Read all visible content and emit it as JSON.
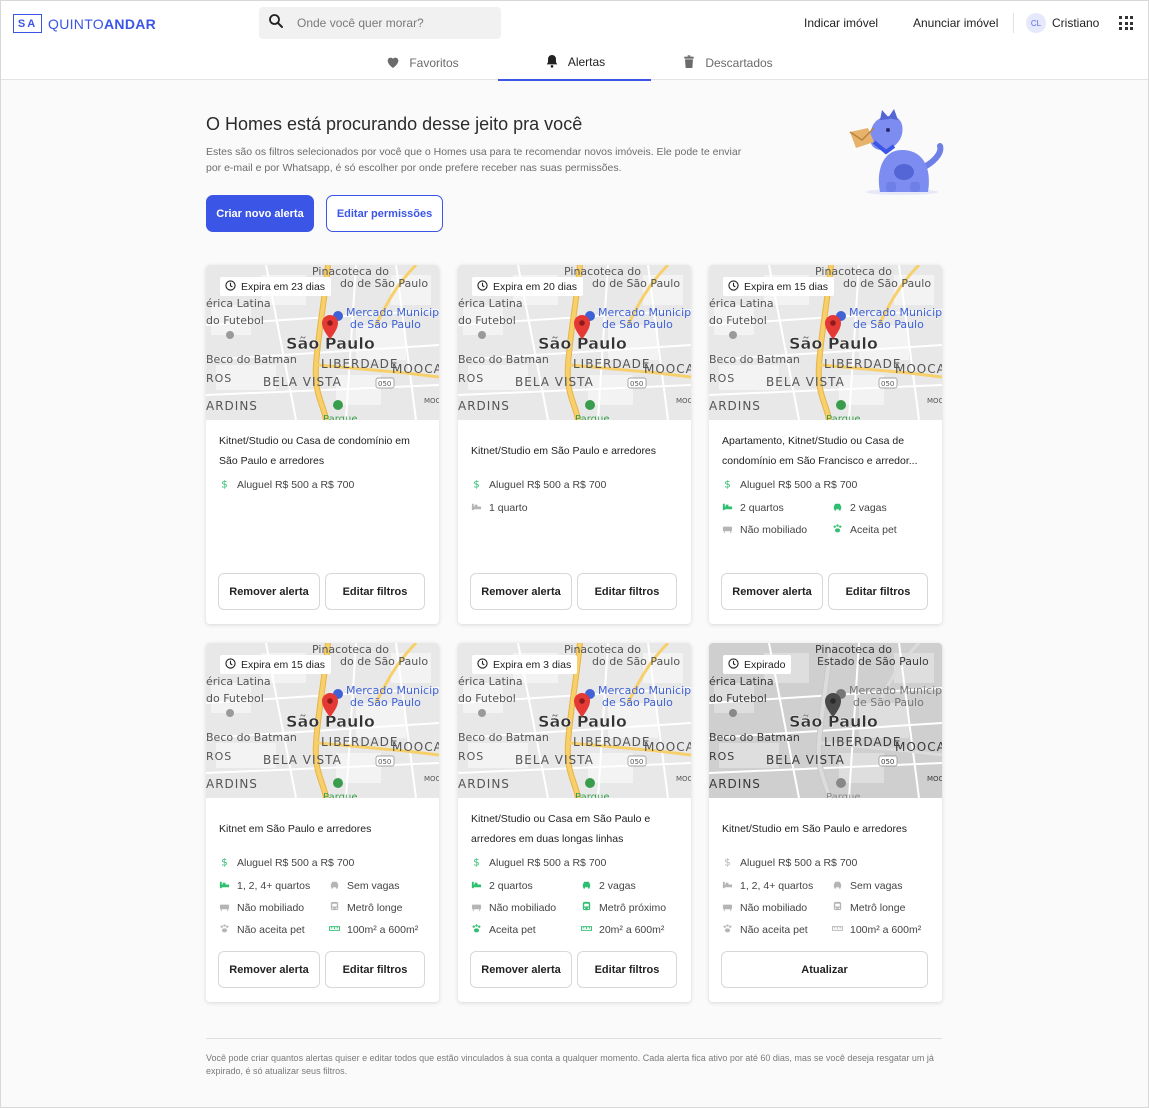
{
  "brand": {
    "mark": "SA",
    "name_light": "QUINTO",
    "name_bold": "ANDAR",
    "accent": "#3b55e6"
  },
  "search": {
    "placeholder": "Onde você quer morar?"
  },
  "header_links": {
    "indicar": "Indicar imóvel",
    "anunciar": "Anunciar imóvel"
  },
  "user": {
    "initials": "CL",
    "name": "Cristiano"
  },
  "tabs": [
    {
      "label": "Favoritos",
      "icon": "heart-icon"
    },
    {
      "label": "Alertas",
      "icon": "bell-icon",
      "active": true
    },
    {
      "label": "Descartados",
      "icon": "trash-icon"
    }
  ],
  "hero": {
    "title": "O Homes está procurando desse jeito pra você",
    "description": "Estes são os filtros selecionados por você que o Homes usa para te recomendar novos imóveis. Ele pode te enviar por e-mail e por Whatsapp, é só escolher por onde prefere receber nas suas permissões.",
    "primary_button": "Criar novo alerta",
    "secondary_button": "Editar permissões"
  },
  "map_labels": {
    "pinacoteca": "Pinacoteca do",
    "pinacoteca2": "do de São Paulo",
    "estado": "Estado de São Paulo",
    "america": "érica Latina",
    "futebol": "do Futebol",
    "mercado": "Mercado Municip",
    "mercado2": "de São Paulo",
    "cidade": "São Paulo",
    "batman": "Beco do Batman",
    "liberdade": "LIBERDADE",
    "mooca": "MOOCA",
    "ros": "ROS",
    "bela_vista": "BELA VISTA",
    "jardins": "ARDINS",
    "road": "050",
    "parque": "Parque",
    "moc": "MOC"
  },
  "alerts": [
    {
      "expire": "Expira em 23 dias",
      "expired": false,
      "title": "Kitnet/Studio ou Casa de condomínio em São Paulo e arredores",
      "features": [
        {
          "icon": "dollar-icon",
          "text": "Aluguel R$ 500 a R$ 700",
          "active": true
        }
      ],
      "buttons": [
        "Remover alerta",
        "Editar filtros"
      ]
    },
    {
      "expire": "Expira em 20 dias",
      "expired": false,
      "title": "Kitnet/Studio em São Paulo e arredores",
      "features": [
        {
          "icon": "dollar-icon",
          "text": "Aluguel R$ 500 a R$ 700",
          "active": true
        },
        {
          "icon": "bed-icon",
          "text": "1 quarto",
          "active": false
        }
      ],
      "buttons": [
        "Remover alerta",
        "Editar filtros"
      ]
    },
    {
      "expire": "Expira em 15 dias",
      "expired": false,
      "title": "Apartamento, Kitnet/Studio ou Casa de condomínio em São Francisco e arredor...",
      "features": [
        {
          "icon": "dollar-icon",
          "text": "Aluguel R$ 500 a R$ 700",
          "active": true
        },
        {
          "icon": "bed-icon",
          "text": "2 quartos",
          "active": true
        },
        {
          "icon": "car-icon",
          "text": "2 vagas",
          "active": true
        },
        {
          "icon": "sofa-icon",
          "text": "Não mobiliado",
          "active": false
        },
        {
          "icon": "paw-icon",
          "text": "Aceita pet",
          "active": true
        }
      ],
      "buttons": [
        "Remover alerta",
        "Editar filtros"
      ]
    },
    {
      "expire": "Expira em 15 dias",
      "expired": false,
      "title": "Kitnet em São Paulo e arredores",
      "features": [
        {
          "icon": "dollar-icon",
          "text": "Aluguel R$ 500 a R$ 700",
          "active": true
        },
        {
          "icon": "bed-icon",
          "text": "1, 2, 4+ quartos",
          "active": true
        },
        {
          "icon": "car-icon",
          "text": "Sem vagas",
          "active": false
        },
        {
          "icon": "sofa-icon",
          "text": "Não mobiliado",
          "active": false
        },
        {
          "icon": "metro-icon",
          "text": "Metrô longe",
          "active": false
        },
        {
          "icon": "paw-icon",
          "text": "Não aceita pet",
          "active": false
        },
        {
          "icon": "ruler-icon",
          "text": "100m² a 600m²",
          "active": true
        }
      ],
      "buttons": [
        "Remover alerta",
        "Editar filtros"
      ]
    },
    {
      "expire": "Expira em 3 dias",
      "expired": false,
      "title": "Kitnet/Studio ou Casa em São Paulo e arredores em duas longas linhas",
      "features": [
        {
          "icon": "dollar-icon",
          "text": "Aluguel R$ 500 a R$ 700",
          "active": true
        },
        {
          "icon": "bed-icon",
          "text": "2 quartos",
          "active": true
        },
        {
          "icon": "car-icon",
          "text": "2 vagas",
          "active": true
        },
        {
          "icon": "sofa-icon",
          "text": "Não mobiliado",
          "active": false
        },
        {
          "icon": "metro-icon",
          "text": "Metrô próximo",
          "active": true
        },
        {
          "icon": "paw-icon",
          "text": "Aceita pet",
          "active": true
        },
        {
          "icon": "ruler-icon",
          "text": "20m² a 600m²",
          "active": true
        }
      ],
      "buttons": [
        "Remover alerta",
        "Editar filtros"
      ]
    },
    {
      "expire": "Expirado",
      "expired": true,
      "title": "Kitnet/Studio em São Paulo e arredores",
      "features": [
        {
          "icon": "dollar-icon",
          "text": "Aluguel R$ 500 a R$ 700",
          "active": false
        },
        {
          "icon": "bed-icon",
          "text": "1, 2, 4+ quartos",
          "active": false
        },
        {
          "icon": "car-icon",
          "text": "Sem vagas",
          "active": false
        },
        {
          "icon": "sofa-icon",
          "text": "Não mobiliado",
          "active": false
        },
        {
          "icon": "metro-icon",
          "text": "Metrô longe",
          "active": false
        },
        {
          "icon": "paw-icon",
          "text": "Não aceita pet",
          "active": false
        },
        {
          "icon": "ruler-icon",
          "text": "100m² a 600m²",
          "active": false
        }
      ],
      "buttons": [
        "Atualizar"
      ]
    }
  ],
  "footer": {
    "text": "Você pode criar quantos alertas quiser e editar todos que estão vinculados à sua conta a qualquer momento. Cada alerta fica ativo por até 60 dias, mas se você deseja resgatar um já expirado, é só atualizar seus filtros."
  },
  "colors": {
    "active_icon": "#2fbf71",
    "inactive_icon": "#b5b5b5",
    "pin": "#e53935"
  }
}
